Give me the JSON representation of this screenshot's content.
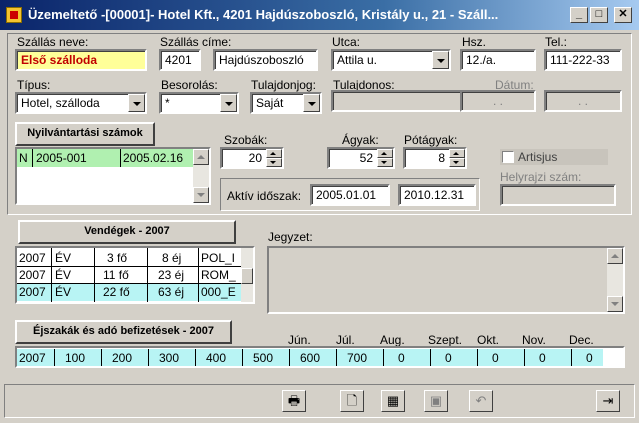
{
  "window": {
    "title": "Üzemeltető -[00001]- Hotel Kft., 4201 Hajdúszoboszló, Kristály u., 21 - Száll...",
    "min": "_",
    "max": "□",
    "close": "✕"
  },
  "fields": {
    "szallas_neve": {
      "label": "Szállás neve:",
      "value": "Első szálloda"
    },
    "szallas_cime": {
      "label": "Szállás címe:",
      "zip": "4201",
      "city": "Hajdúszoboszló"
    },
    "utca": {
      "label": "Utca:",
      "value": "Attila u."
    },
    "hsz": {
      "label": "Hsz.",
      "value": "12./a."
    },
    "tel": {
      "label": "Tel.:",
      "value": "111-222-33"
    },
    "tipus": {
      "label": "Típus:",
      "value": "Hotel, szálloda"
    },
    "besorolas": {
      "label": "Besorolás:",
      "value": "*"
    },
    "tulajdonjog": {
      "label": "Tulajdonjog:",
      "value": "Saját"
    },
    "tulajdonos": {
      "label": "Tulajdonos:",
      "value": ""
    },
    "datum": {
      "label": "Dátum:",
      "from": ". .",
      "to": ". ."
    }
  },
  "nyilvantartasi": {
    "button": "Nyilvántartási számok",
    "rows": [
      {
        "c1": "N",
        "c2": "2005-001",
        "c3": "2005.02.16"
      }
    ]
  },
  "capacity": {
    "szobak": {
      "label": "Szobák:",
      "value": "20"
    },
    "agyak": {
      "label": "Ágyak:",
      "value": "52"
    },
    "potagyak": {
      "label": "Pótágyak:",
      "value": "8"
    }
  },
  "aktiv": {
    "label": "Aktív időszak:",
    "from": "2005.01.01",
    "to": "2010.12.31"
  },
  "artisjus": {
    "label": "Artisjus",
    "checked": false
  },
  "helyrajzi": {
    "label": "Helyrajzi szám:",
    "value": ""
  },
  "vendegek": {
    "button": "Vendégek - 2007",
    "rows": [
      {
        "year": "2007",
        "type": "ÉV",
        "persons": "3 fő",
        "nights": "8 éj",
        "code": "POL_I"
      },
      {
        "year": "2007",
        "type": "ÉV",
        "persons": "11 fő",
        "nights": "23 éj",
        "code": "ROM_"
      },
      {
        "year": "2007",
        "type": "ÉV",
        "persons": "22 fő",
        "nights": "63 éj",
        "code": "000_E"
      }
    ]
  },
  "jegyzet": {
    "label": "Jegyzet:",
    "value": ""
  },
  "ejszakak": {
    "button": "Éjszakák és adó befizetések - 2007",
    "headers": [
      "Jún.",
      "Júl.",
      "Aug.",
      "Szept.",
      "Okt.",
      "Nov.",
      "Dec."
    ],
    "values": [
      "2007",
      "100",
      "200",
      "300",
      "400",
      "500",
      "600",
      "700",
      "0",
      "0",
      "0",
      "0",
      "0"
    ]
  },
  "toolbar": {
    "print": "print-icon",
    "new": "new-doc-icon",
    "calendar": "calendar-icon",
    "save": "save-icon",
    "undo": "undo-icon",
    "exit": "exit-icon"
  }
}
